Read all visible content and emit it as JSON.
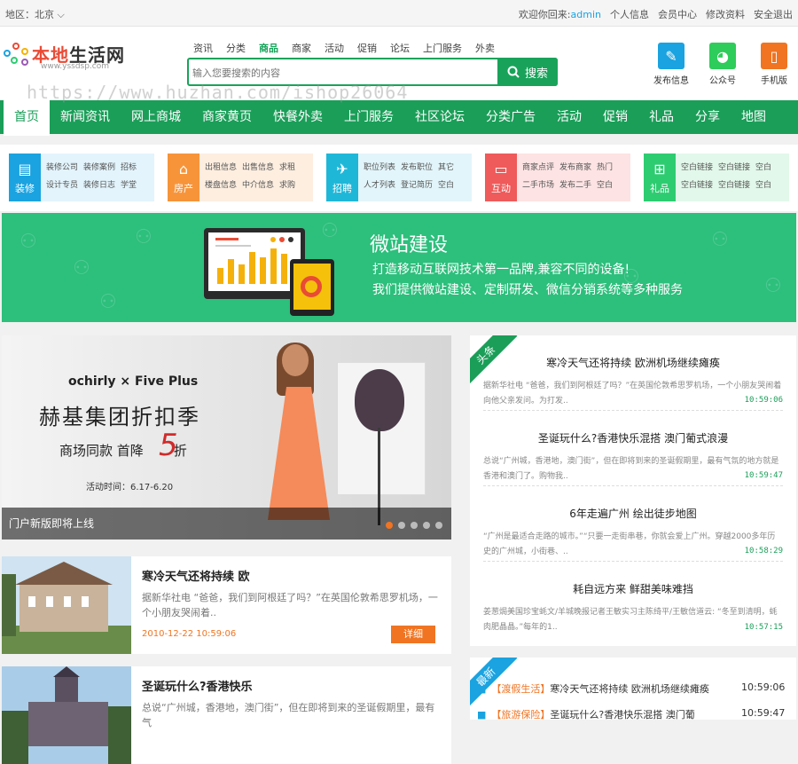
{
  "topbar": {
    "region": "地区：北京",
    "welcome": "欢迎你回来:",
    "user": "admin",
    "links": [
      "个人信息",
      "会员中心",
      "修改资料",
      "安全退出"
    ]
  },
  "logo": {
    "name_a": "本地",
    "name_b": "生活网",
    "url": "www.yssdsp.com"
  },
  "search": {
    "tabs": [
      "资讯",
      "分类",
      "商品",
      "商家",
      "活动",
      "促销",
      "论坛",
      "上门服务",
      "外卖"
    ],
    "active_tab": "商品",
    "placeholder": "输入您要搜索的内容",
    "button": "搜索"
  },
  "header_icons": [
    {
      "label": "发布信息",
      "color": "#1aa3e0",
      "icon": "edit-icon"
    },
    {
      "label": "公众号",
      "color": "#2ecc5a",
      "icon": "wechat-icon"
    },
    {
      "label": "手机版",
      "color": "#f07422",
      "icon": "mobile-icon"
    }
  ],
  "watermark": "https://www.huzhan.com/ishop26064",
  "nav": [
    "首页",
    "新闻资讯",
    "网上商城",
    "商家黄页",
    "快餐外卖",
    "上门服务",
    "社区论坛",
    "分类广告",
    "活动",
    "促销",
    "礼品",
    "分享",
    "地图"
  ],
  "categories": [
    {
      "tag": "装修",
      "color": "#1aa3e0",
      "bg": "#e3f4fc",
      "links": [
        [
          "装修公司",
          "装修案例",
          "招标"
        ],
        [
          "设计专员",
          "装修日志",
          "学堂"
        ]
      ]
    },
    {
      "tag": "房产",
      "color": "#f7943a",
      "bg": "#fdeee0",
      "links": [
        [
          "出租信息",
          "出售信息",
          "求租"
        ],
        [
          "楼盘信息",
          "中介信息",
          "求购"
        ]
      ]
    },
    {
      "tag": "招聘",
      "color": "#1fb7d8",
      "bg": "#e2f5fa",
      "links": [
        [
          "职位列表",
          "发布职位",
          "其它"
        ],
        [
          "人才列表",
          "登记简历",
          "空白"
        ]
      ]
    },
    {
      "tag": "互动",
      "color": "#ef5a5a",
      "bg": "#fde3e3",
      "links": [
        [
          "商家点评",
          "发布商家",
          "热门"
        ],
        [
          "二手市场",
          "发布二手",
          "空白"
        ]
      ]
    },
    {
      "tag": "礼品",
      "color": "#2ecc71",
      "bg": "#e2f8ea",
      "links": [
        [
          "空白链接",
          "空白链接",
          "空白"
        ],
        [
          "空白链接",
          "空白链接",
          "空白"
        ]
      ]
    }
  ],
  "banner": {
    "title": "微站建设",
    "line1": "打造移动互联网技术第一品牌,兼容不同的设备!",
    "line2": "我们提供微站建设、定制研发、微信分销系统等多种服务"
  },
  "slider": {
    "brand": "ochirly × Five Plus",
    "headline": "赫基集团折扣季",
    "sub": "商场同款 首降",
    "discount": "5",
    "suffix": "折",
    "date": "活动时间：6.17-6.20",
    "caption": "门户新版即将上线",
    "active_dot": 0,
    "dot_count": 5
  },
  "articles": [
    {
      "title": "寒冷天气还将持续 欧",
      "desc": "据新华社电 “爸爸，我们到阿根廷了吗？”在英国伦敦希思罗机场，一个小朋友哭闹着..",
      "time": "2010-12-22 10:59:06",
      "more": "详细"
    },
    {
      "title": "圣诞玩什么?香港快乐",
      "desc": "总说“广州城，香港地，澳门街”，但在即将到来的圣诞假期里，最有气",
      "time": "",
      "more": ""
    }
  ],
  "headlines": {
    "ribbon": "头条",
    "items": [
      {
        "title": "寒冷天气还将持续 欧洲机场继续瘫痪",
        "desc": "据新华社电 “爸爸，我们到阿根廷了吗？”在英国伦敦希思罗机场，一个小朋友哭闹着向他父亲发问。为打发..",
        "time": "10:59:06"
      },
      {
        "title": "圣诞玩什么?香港快乐混搭 澳门葡式浪漫",
        "desc": "总说“广州城，香港地，澳门街”，但在即将到来的圣诞假期里，最有气氛的地方就是香港和澳门了。购物我..",
        "time": "10:59:47"
      },
      {
        "title": "6年走遍广州 绘出徒步地图",
        "desc": "“广州是最适合走路的城市。”“只要一走街串巷，你就会爱上广州。穿越2000多年历史的广州城，小街巷、..",
        "time": "10:58:29"
      },
      {
        "title": "耗自远方来 鲜甜美味难挡",
        "desc": "姜葱焗美国珍宝蚝文/羊城晚报记者王敏实习主陈绮平/王敏信道云: “冬至到清明，蚝肉肥晶晶。”每年的1..",
        "time": "10:57:15"
      }
    ]
  },
  "latest": {
    "ribbon": "最新",
    "items": [
      {
        "cat": "【渡假生活】",
        "title": "寒冷天气还将持续 欧洲机场继续瘫痪",
        "time": "10:59:06"
      },
      {
        "cat": "【旅游保险】",
        "title": "圣诞玩什么?香港快乐混搭 澳门葡",
        "time": "10:59:47"
      }
    ]
  }
}
